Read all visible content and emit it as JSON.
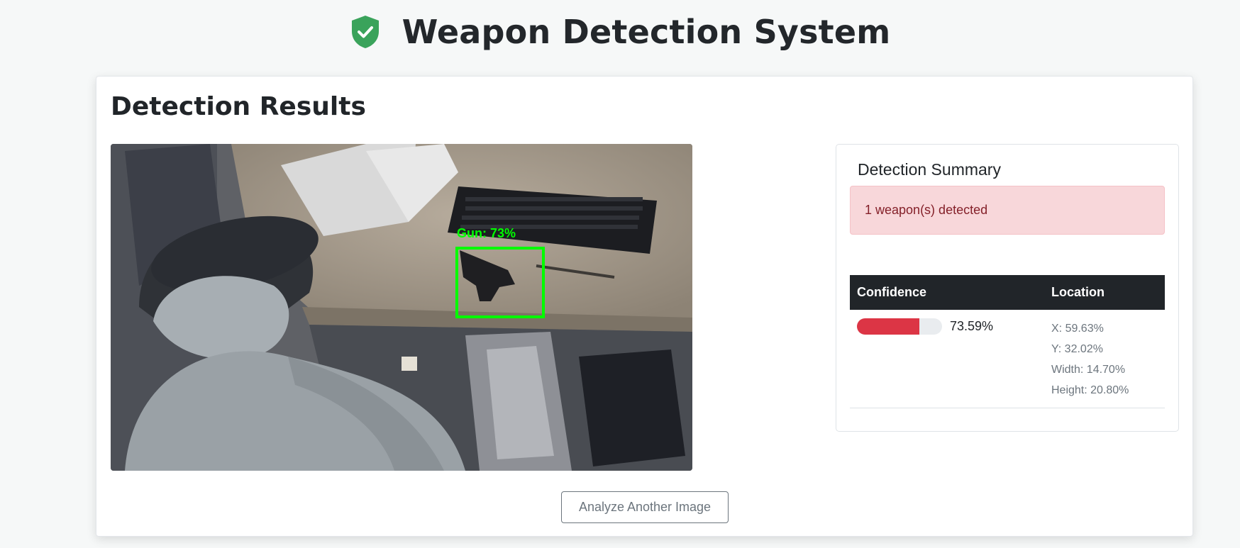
{
  "app": {
    "title": "Weapon Detection System",
    "logo_icon": "shield-check-icon",
    "logo_color": "#3aa35b"
  },
  "results": {
    "heading": "Detection Results",
    "image": {
      "label": "Gun: 73%",
      "box_color": "#00ff00"
    },
    "summary": {
      "heading": "Detection Summary",
      "alert_text": "1 weapon(s) detected",
      "table": {
        "headers": [
          "Confidence",
          "Location"
        ],
        "rows": [
          {
            "confidence_value": 0.7359,
            "confidence_text": "73.59%",
            "location": [
              "X: 59.63%",
              "Y: 32.02%",
              "Width: 14.70%",
              "Height: 20.80%"
            ]
          }
        ]
      }
    },
    "analyze_button": "Analyze Another Image"
  },
  "colors": {
    "danger": "#dc3545",
    "alert_bg": "#f8d7da",
    "table_header": "#212529"
  }
}
